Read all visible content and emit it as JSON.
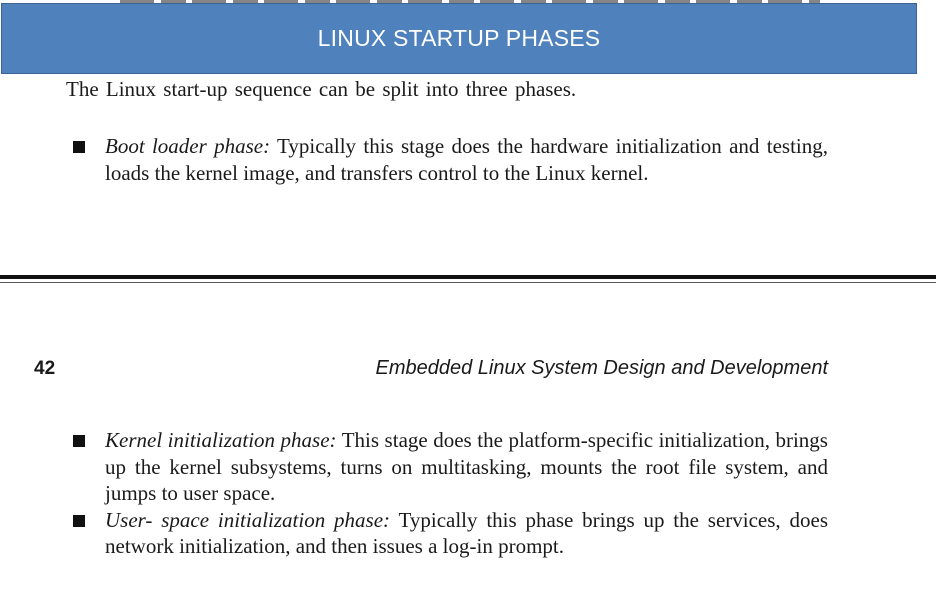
{
  "banner": {
    "title": "LINUX STARTUP PHASES"
  },
  "intro": "The Linux start-up sequence can be split into three phases.",
  "page_top": {
    "bullets": [
      {
        "term": "Boot loader phase:",
        "text": " Typically this stage does the hardware initialization and testing, loads the kernel image, and transfers control to the Linux kernel."
      }
    ]
  },
  "page_bottom": {
    "page_number": "42",
    "running_head": "Embedded Linux System Design and Development",
    "bullets": [
      {
        "term": "Kernel initialization phase:",
        "text": " This stage does the platform-specific initialization, brings up the kernel subsystems, turns on multitasking, mounts the root file system, and jumps to user space."
      },
      {
        "term": "User- space initialization phase:",
        "text": " Typically this phase brings up the services, does network initialization, and then issues a log-in prompt."
      }
    ]
  },
  "colors": {
    "banner_bg": "#4f81bd",
    "banner_text": "#ffffff",
    "body_text": "#1a1a1a"
  }
}
